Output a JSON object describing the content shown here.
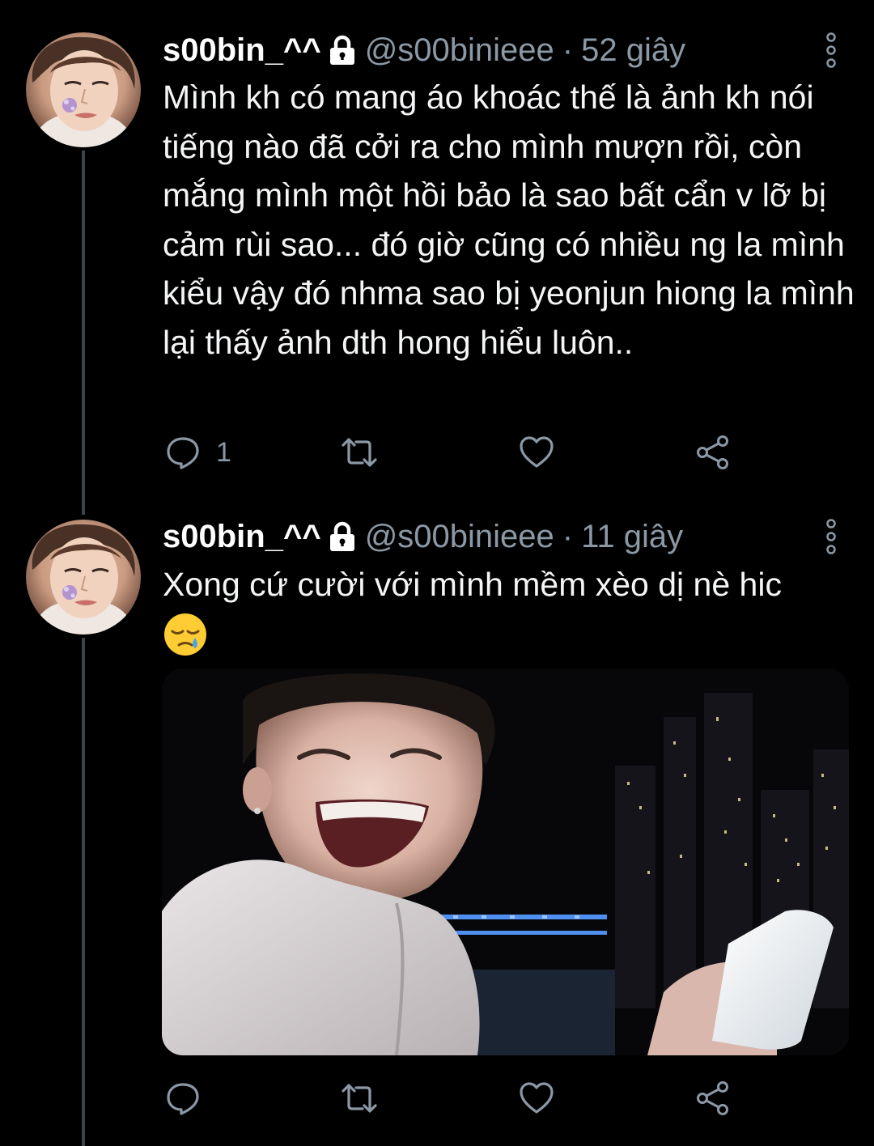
{
  "colors": {
    "background": "#000000",
    "text": "#f4f5f6",
    "secondary_text": "#8b98a5",
    "thread_line": "#3d4148",
    "icon": "#8b98a5"
  },
  "tweets": [
    {
      "display_name": "s00bin_^^",
      "protected_icon": "lock-icon",
      "handle": "@s00binieee",
      "separator": "·",
      "time": "52 giây",
      "text": "Mình kh có mang áo khoác thế là ảnh kh nói tiếng nào đã cởi ra cho mình mượn rồi, còn mắng mình một hồi bảo là sao bất cẩn v lỡ bị cảm rùi sao... đó giờ cũng có nhiều ng la mình kiểu vậy đó nhma sao bị yeonjun hiong la mình lại thấy ảnh dth hong hiểu luôn..",
      "actions": {
        "reply_icon": "reply-icon",
        "reply_count": "1",
        "retweet_icon": "retweet-icon",
        "like_icon": "heart-icon",
        "share_icon": "share-icon"
      }
    },
    {
      "display_name": "s00bin_^^",
      "protected_icon": "lock-icon",
      "handle": "@s00binieee",
      "separator": "·",
      "time": "11 giây",
      "text": "Xong cứ cười với mình mềm xèo dị nè hic",
      "emoji": "sleepy-face-emoji",
      "media": "photo of a young man laughing at night in front of a city skyline, holding a phone",
      "actions": {
        "reply_icon": "reply-icon",
        "reply_count": "",
        "retweet_icon": "retweet-icon",
        "like_icon": "heart-icon",
        "share_icon": "share-icon"
      }
    }
  ]
}
